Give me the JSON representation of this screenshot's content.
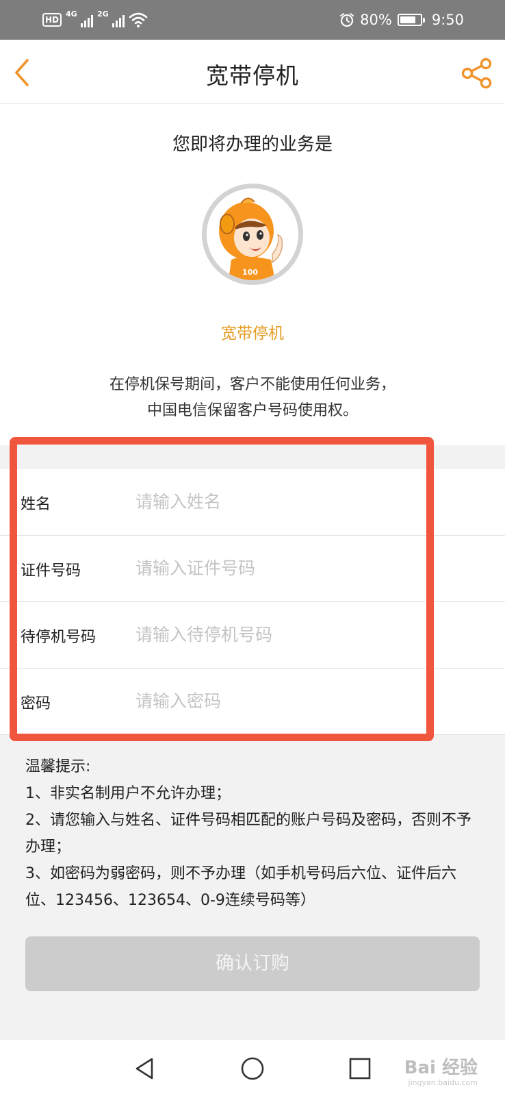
{
  "status_bar": {
    "hd_label": "HD",
    "sim1_network": "4G",
    "sim2_network": "2G",
    "battery_percent": "80%",
    "battery_level": 0.8,
    "time": "9:50"
  },
  "nav": {
    "title": "宽带停机",
    "back_icon": "chevron-left-icon",
    "share_icon": "share-icon"
  },
  "intro": {
    "heading": "您即将办理的业务是",
    "service_name": "宽带停机",
    "description_line1": "在停机保号期间，客户不能使用任何业务，",
    "description_line2": "中国电信保留客户号码使用权。"
  },
  "form": {
    "fields": [
      {
        "label": "姓名",
        "placeholder": "请输入姓名",
        "value": ""
      },
      {
        "label": "证件号码",
        "placeholder": "请输入证件号码",
        "value": ""
      },
      {
        "label": "待停机号码",
        "placeholder": "请输入待停机号码",
        "value": ""
      },
      {
        "label": "密码",
        "placeholder": "请输入密码",
        "value": ""
      }
    ]
  },
  "tips": {
    "title": "温馨提示:",
    "lines": [
      "1、非实名制用户不允许办理；",
      "2、请您输入与姓名、证件号码相匹配的账户号码及密码，否则不予办理；",
      "3、如密码为弱密码，则不予办理（如手机号码后六位、证件后六位、123456、123654、0-9连续号码等）"
    ]
  },
  "confirm_button": "确认订购",
  "watermark": {
    "text": "Bai 经验",
    "sub": "jingyan.baidu.com"
  },
  "colors": {
    "accent": "#e59a1e",
    "highlight": "#f0553d",
    "button_disabled": "#cccccc",
    "status_bar": "#7d7d7d"
  }
}
